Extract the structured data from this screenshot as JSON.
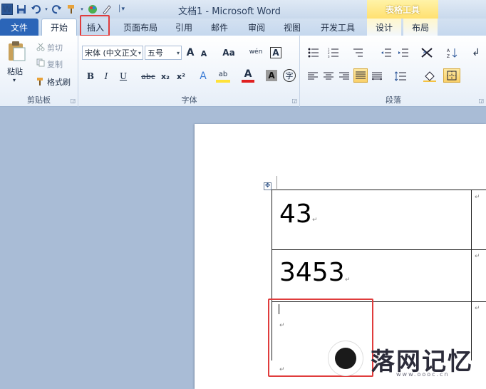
{
  "window": {
    "title": "文档1 - Microsoft Word",
    "context_tab_header": "表格工具"
  },
  "quick_access": {
    "word_logo": "W",
    "icons": [
      "save-icon",
      "undo-icon",
      "redo-icon",
      "format-painter-icon",
      "color-icon",
      "customize-icon"
    ]
  },
  "tabs": [
    "文件",
    "开始",
    "插入",
    "页面布局",
    "引用",
    "邮件",
    "审阅",
    "视图",
    "开发工具",
    "设计",
    "布局"
  ],
  "ribbon": {
    "clipboard": {
      "label": "剪贴板",
      "paste": "粘贴",
      "cut": "剪切",
      "copy": "复制",
      "format_painter": "格式刷"
    },
    "font": {
      "label": "字体",
      "font_name": "宋体 (中文正文",
      "font_size": "五号",
      "grow": "A",
      "shrink": "A",
      "change_case": "Aa",
      "phonetic": "wén",
      "border_char": "A",
      "bold": "B",
      "italic": "I",
      "underline": "U",
      "strike": "abc",
      "subscript": "x₂",
      "superscript": "x²",
      "highlight": "ab",
      "font_color": "A",
      "shading": "A",
      "enclose": "字"
    },
    "paragraph": {
      "label": "段落"
    }
  },
  "document": {
    "table": {
      "rows": [
        "43",
        "3453",
        ""
      ]
    },
    "paragraph_mark": "↵",
    "cursor_mark": "|"
  },
  "watermark": {
    "text": "落网记忆",
    "url": "www.oooc.cn"
  },
  "colors": {
    "accent": "#2b65b8",
    "highlight_red": "#e03c3c",
    "context_tab": "#ffe070"
  }
}
